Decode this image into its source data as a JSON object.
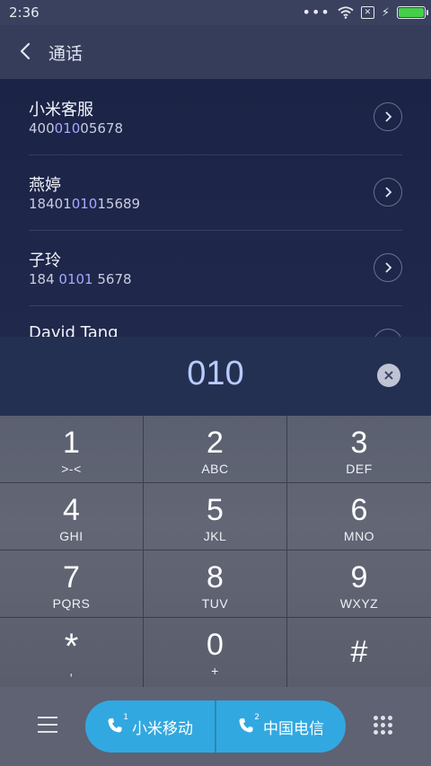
{
  "status": {
    "time": "2:36",
    "more": "•••"
  },
  "header": {
    "title": "通话"
  },
  "contacts": [
    {
      "name": "小米客服",
      "num_pre": "400",
      "num_hl": "010",
      "num_post": "05678"
    },
    {
      "name": "燕婷",
      "num_pre": "18401",
      "num_hl": "010",
      "num_post": "15689"
    },
    {
      "name": "子玲",
      "num_pre": "184 ",
      "num_hl": "0101",
      "num_post": " 5678"
    },
    {
      "name": "David Tang",
      "num_pre": "",
      "num_hl": "",
      "num_post": ""
    }
  ],
  "input": {
    "digits": "010",
    "clear_symbol": "×"
  },
  "keypad": [
    {
      "digit": "1",
      "letters": ">-<"
    },
    {
      "digit": "2",
      "letters": "ABC"
    },
    {
      "digit": "3",
      "letters": "DEF"
    },
    {
      "digit": "4",
      "letters": "GHI"
    },
    {
      "digit": "5",
      "letters": "JKL"
    },
    {
      "digit": "6",
      "letters": "MNO"
    },
    {
      "digit": "7",
      "letters": "PQRS"
    },
    {
      "digit": "8",
      "letters": "TUV"
    },
    {
      "digit": "9",
      "letters": "WXYZ"
    },
    {
      "digit": "*",
      "letters": ","
    },
    {
      "digit": "0",
      "letters": "+"
    },
    {
      "digit": "#",
      "letters": ""
    }
  ],
  "bottom": {
    "sim1": {
      "label": "小米移动",
      "slot": "1"
    },
    "sim2": {
      "label": "中国电信",
      "slot": "2"
    }
  },
  "colors": {
    "accent": "#32a8e0",
    "highlight": "#a7a9ff",
    "battery": "#45d04a"
  }
}
